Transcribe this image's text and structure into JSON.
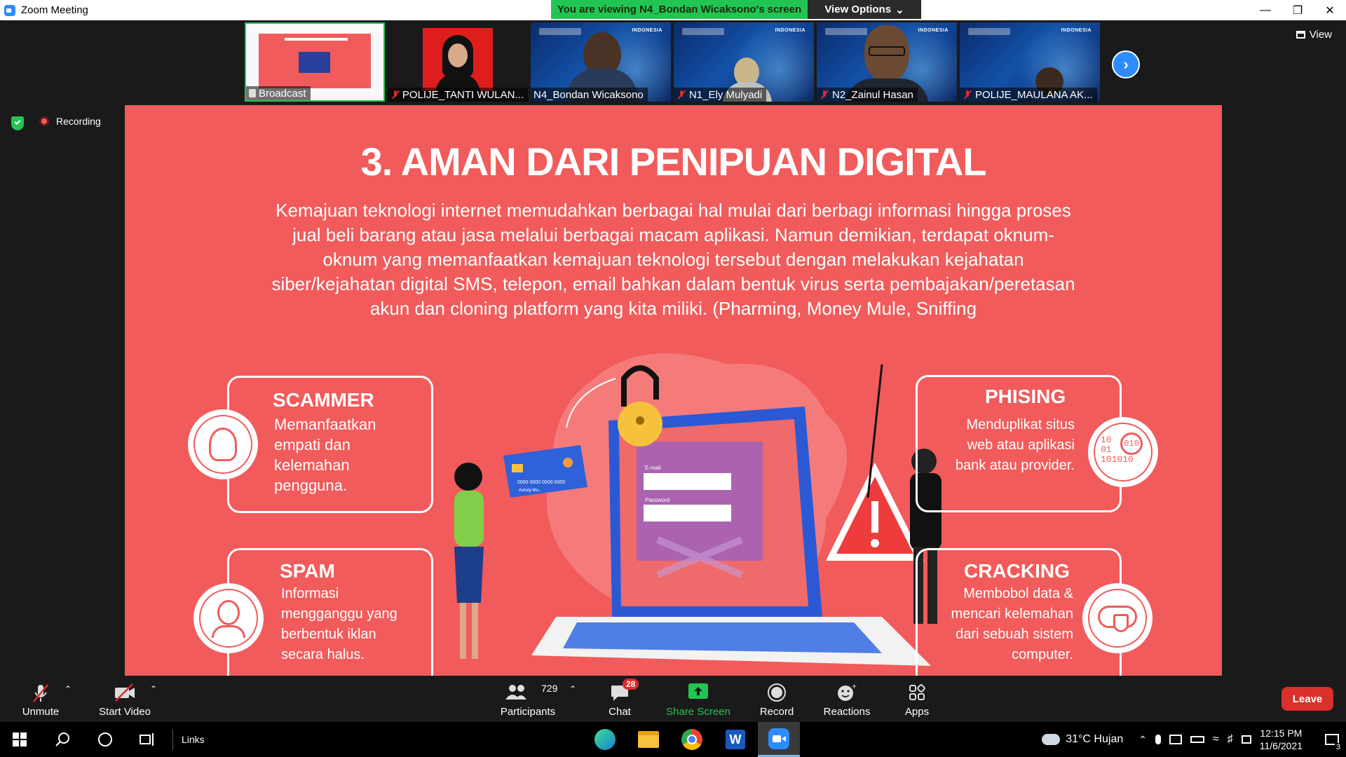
{
  "window": {
    "title": "Zoom Meeting"
  },
  "banner": {
    "viewing": "You are viewing N4_Bondan Wicaksono's screen",
    "options": "View Options"
  },
  "gallery": {
    "view_label": "View",
    "tiles": [
      {
        "name": "Broadcast"
      },
      {
        "name": "POLIJE_TANTI WULAN..."
      },
      {
        "name": "N4_Bondan Wicaksono"
      },
      {
        "name": "N1_Ely Mulyadi"
      },
      {
        "name": "N2_Zainul Hasan"
      },
      {
        "name": "POLIJE_MAULANA AK..."
      }
    ],
    "tag": "INDONESIA"
  },
  "recording": {
    "label": "Recording"
  },
  "slide": {
    "title": "3. AMAN DARI PENIPUAN DIGITAL",
    "body": [
      "Kemajuan teknologi internet memudahkan berbagai hal mulai dari berbagi informasi hingga proses",
      "jual beli barang atau jasa melalui berbagai macam aplikasi. Namun demikian, terdapat oknum-",
      "oknum yang memanfaatkan kemajuan teknologi tersebut dengan melakukan kejahatan",
      "siber/kejahatan digital SMS, telepon, email bahkan dalam bentuk virus serta pembajakan/peretasan",
      "akun dan cloning platform yang kita miliki. (Pharming, Money Mule, Sniffing"
    ],
    "cards": {
      "scammer": {
        "title": "SCAMMER",
        "text": [
          "Memanfaatkan",
          "empati dan",
          "kelemahan",
          "pengguna."
        ]
      },
      "phising": {
        "title": "PHISING",
        "text": [
          "Menduplikat situs",
          "web atau aplikasi",
          "bank atau provider."
        ]
      },
      "spam": {
        "title": "SPAM",
        "text": [
          "Informasi",
          "mengganggu yang",
          "berbentuk iklan",
          "secara halus."
        ]
      },
      "cracking": {
        "title": "CRACKING",
        "text": [
          "Membobol data &",
          "mencari kelemahan",
          "dari sebuah sistem",
          "computer."
        ]
      }
    },
    "illus": {
      "email_label": "E-mail",
      "password_label": "Password",
      "card_number": "0000 0000 0000 0000",
      "card_holder": "Ashely Mo...",
      "binary": [
        "10",
        "01",
        "101010",
        "010"
      ]
    }
  },
  "controls": {
    "unmute": "Unmute",
    "start_video": "Start Video",
    "participants": "Participants",
    "participants_count": "729",
    "chat": "Chat",
    "chat_badge": "28",
    "share": "Share Screen",
    "record": "Record",
    "reactions": "Reactions",
    "apps": "Apps",
    "leave": "Leave"
  },
  "taskbar": {
    "links": "Links",
    "weather": "31°C  Hujan",
    "time": "12:15 PM",
    "date": "11/6/2021",
    "notif_count": "3"
  },
  "colors": {
    "zoom_blue": "#2d8cff",
    "green": "#23c552",
    "slide_red": "#f25b5b",
    "leave_red": "#d9302c"
  }
}
